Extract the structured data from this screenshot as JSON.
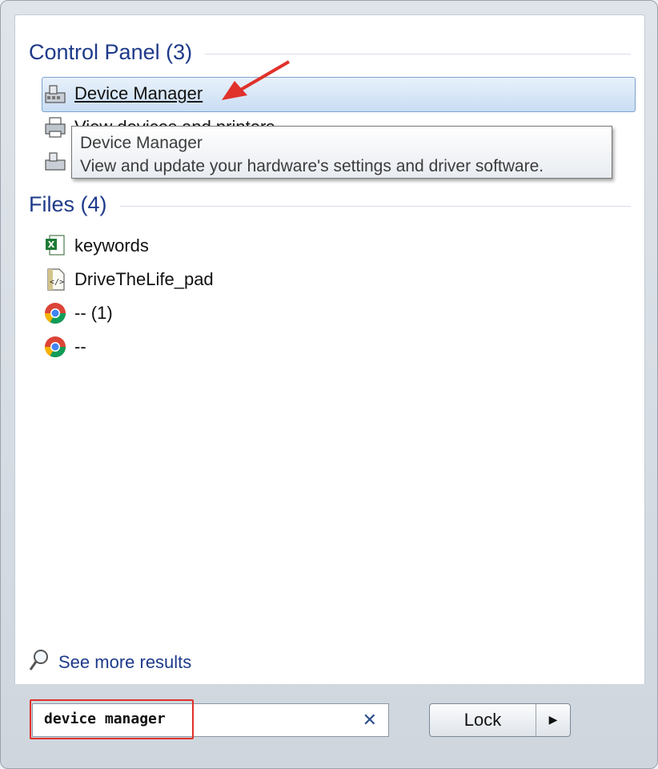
{
  "control_panel": {
    "header": "Control Panel (3)",
    "items": [
      {
        "label": "Device Manager",
        "icon": "device-manager-icon"
      },
      {
        "label": "View devices and printers",
        "icon": "printer-icon"
      },
      {
        "label": "",
        "icon": "device-manager-icon"
      }
    ]
  },
  "tooltip": {
    "title": "Device Manager",
    "description": "View and update your hardware's settings and driver software."
  },
  "files": {
    "header": "Files (4)",
    "items": [
      {
        "label": "keywords",
        "icon": "excel-file-icon"
      },
      {
        "label": "DriveTheLife_pad",
        "icon": "code-file-icon"
      },
      {
        "label": "-- (1)",
        "icon": "chrome-icon"
      },
      {
        "label": "--",
        "icon": "chrome-icon"
      }
    ]
  },
  "see_more": {
    "label": "See more results",
    "icon": "magnifier-icon"
  },
  "search": {
    "value": "device manager",
    "clear_icon": "close-icon"
  },
  "lock_button": {
    "label": "Lock",
    "arrow_icon": "arrow-right-icon"
  },
  "colors": {
    "header_text": "#1e3a8a",
    "selection": "#c9ddf3",
    "annotation": "#e0312b"
  }
}
